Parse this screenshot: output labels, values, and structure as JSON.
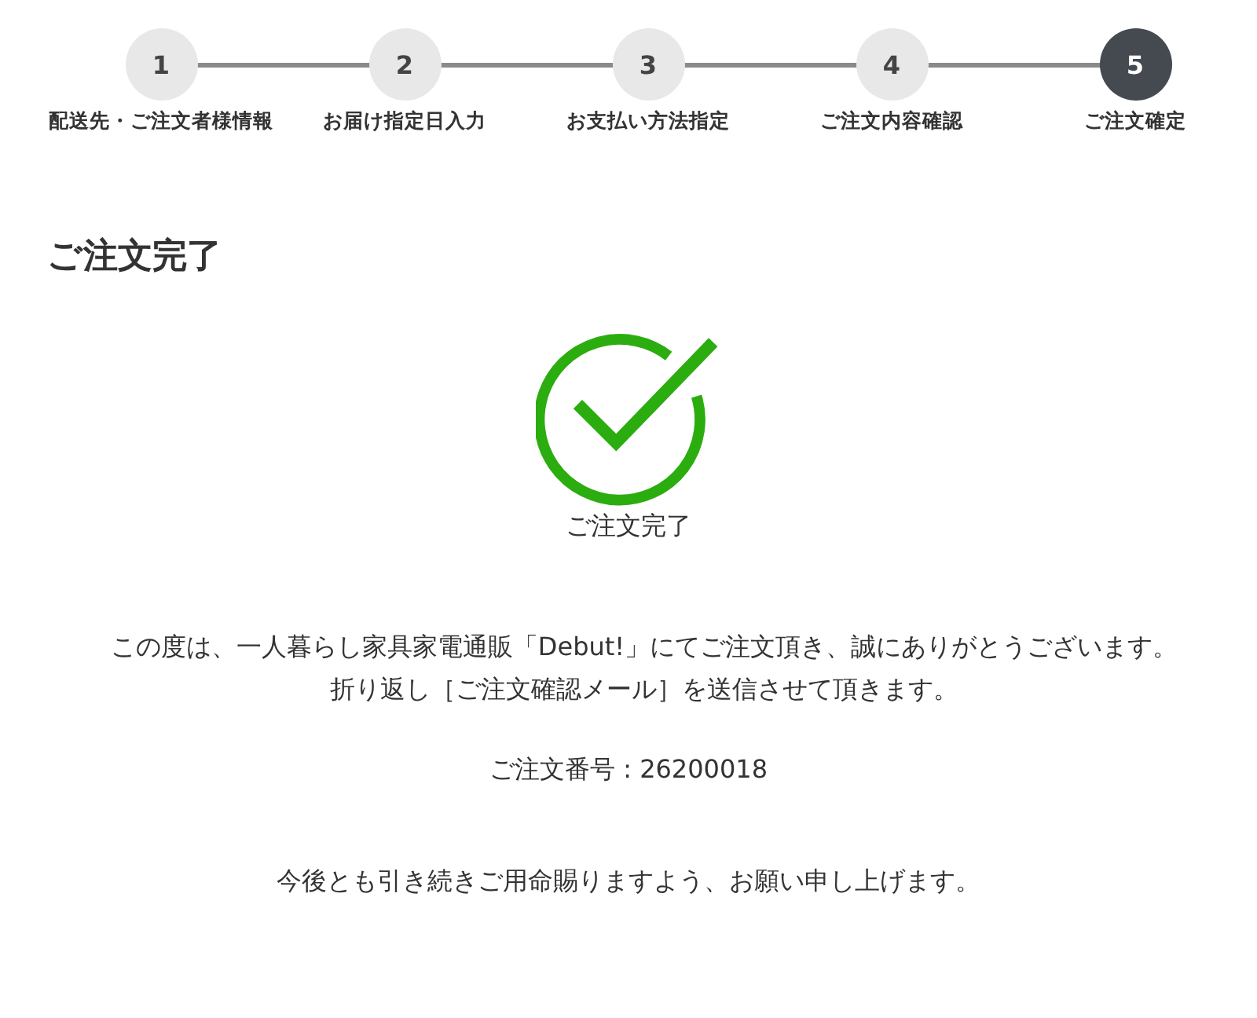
{
  "steps": [
    {
      "number": "1",
      "label": "配送先・ご注文者様情報",
      "selected": false
    },
    {
      "number": "2",
      "label": "お届け指定日入力",
      "selected": false
    },
    {
      "number": "3",
      "label": "お支払い方法指定",
      "selected": false
    },
    {
      "number": "4",
      "label": "ご注文内容確認",
      "selected": false
    },
    {
      "number": "5",
      "label": "ご注文確定",
      "selected": true
    }
  ],
  "heading": "ご注文完了",
  "status": {
    "label": "ご注文完了"
  },
  "message": [
    "この度は、一人暮らし家具家電通販「Debut!」にてご注文頂き、誠にありがとうございます。",
    "折り返し［ご注文確認メール］を送信させて頂きます。"
  ],
  "order_number": "ご注文番号 : 26200018",
  "closing": "今後とも引き続きご用命賜りますよう、お願い申し上げます。"
}
